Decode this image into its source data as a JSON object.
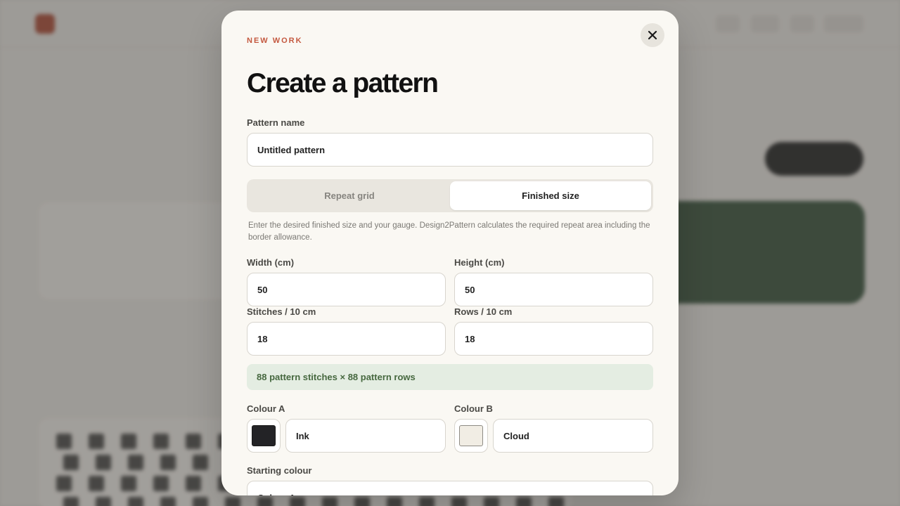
{
  "modal": {
    "eyebrow": "NEW WORK",
    "title": "Create a pattern",
    "pattern_name": {
      "label": "Pattern name",
      "value": "Untitled pattern"
    },
    "mode_tabs": [
      {
        "label": "Repeat grid",
        "active": false
      },
      {
        "label": "Finished size",
        "active": true
      }
    ],
    "help_text": "Enter the desired finished size and your gauge. Design2Pattern calculates the required repeat area including the border allowance.",
    "width": {
      "label": "Width (cm)",
      "value": "50"
    },
    "height": {
      "label": "Height (cm)",
      "value": "50"
    },
    "stitches": {
      "label": "Stitches / 10 cm",
      "value": "18"
    },
    "rows": {
      "label": "Rows / 10 cm",
      "value": "18"
    },
    "summary": "88 pattern stitches × 88 pattern rows",
    "colour_a": {
      "label": "Colour A",
      "name": "Ink",
      "swatch": "#232326"
    },
    "colour_b": {
      "label": "Colour B",
      "name": "Cloud",
      "swatch": "#f1ede4"
    },
    "starting_colour": {
      "label": "Starting colour",
      "value": "Colour A"
    }
  },
  "colors": {
    "accent": "#c4583f",
    "summary_bg": "#e4ede2",
    "summary_text": "#46683f",
    "modal_bg": "#faf8f3"
  }
}
